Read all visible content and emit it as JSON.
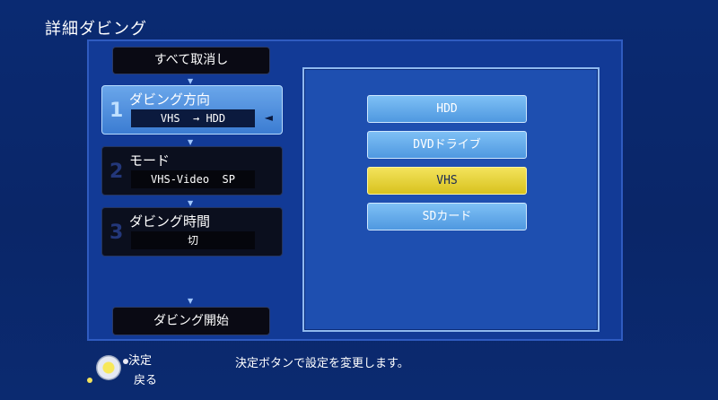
{
  "header": {
    "title": "詳細ダビング"
  },
  "actions": {
    "clear_all": "すべて取消し",
    "start": "ダビング開始"
  },
  "steps": [
    {
      "num": "1",
      "label": "ダビング方向",
      "value": "VHS  → HDD"
    },
    {
      "num": "2",
      "label": "モード",
      "value": "VHS-Video  SP"
    },
    {
      "num": "3",
      "label": "ダビング時間",
      "value": "切"
    }
  ],
  "options": {
    "items": [
      "HDD",
      "DVDドライブ",
      "VHS",
      "SDカード"
    ],
    "selected": "VHS"
  },
  "footer": {
    "ok_label": "決定",
    "back_label": "戻る",
    "message": "決定ボタンで設定を変更します。"
  },
  "colors": {
    "highlight_yellow": "#d8c21e",
    "option_blue": "#5aa2e6",
    "panel_blue": "#123a96"
  },
  "icons": {
    "pointer": "◄",
    "down_arrow": "▼"
  }
}
